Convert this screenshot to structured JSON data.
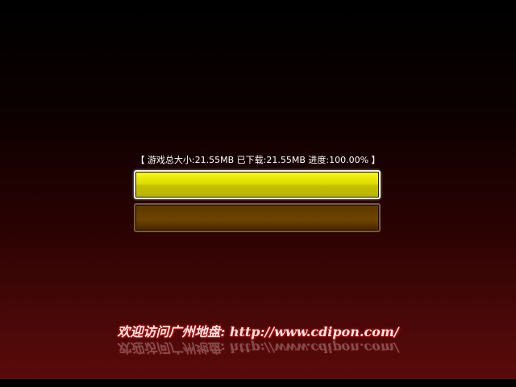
{
  "status_text": "【 游戏总大小:21.55MB 已下载:21.55MB 进度:100.00% 】",
  "progress": {
    "fraction": 1.0,
    "fill_color": "#e0de00",
    "track_color": "#2a2000"
  },
  "site_text": "欢迎访问广州地盘: http://www.cdipon.com/",
  "colors": {
    "background_top": "#000000",
    "background_bottom": "#5a0a0a"
  }
}
